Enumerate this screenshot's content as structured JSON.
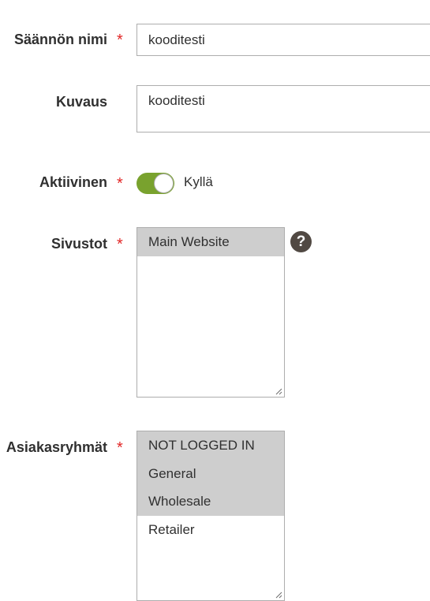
{
  "form": {
    "rule_name": {
      "label": "Säännön nimi",
      "required_mark": "*",
      "value": "kooditesti"
    },
    "description": {
      "label": "Kuvaus",
      "value": "kooditesti"
    },
    "active": {
      "label": "Aktiivinen",
      "required_mark": "*",
      "state_text": "Kyllä",
      "enabled": true
    },
    "websites": {
      "label": "Sivustot",
      "required_mark": "*",
      "help_symbol": "?",
      "options": [
        {
          "label": "Main Website",
          "selected": true
        }
      ]
    },
    "customer_groups": {
      "label": "Asiakasryhmät",
      "required_mark": "*",
      "options": [
        {
          "label": "NOT LOGGED IN",
          "selected": true
        },
        {
          "label": "General",
          "selected": true
        },
        {
          "label": "Wholesale",
          "selected": true
        },
        {
          "label": "Retailer",
          "selected": false
        }
      ]
    }
  },
  "colors": {
    "toggle_on": "#79a22e",
    "required_star": "#e22626",
    "selected_option_bg": "#cecece",
    "help_icon_bg": "#514943"
  }
}
